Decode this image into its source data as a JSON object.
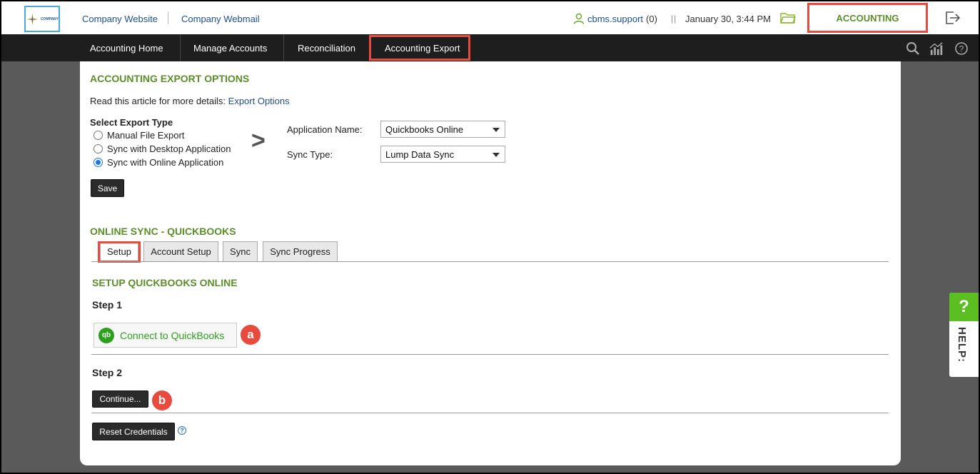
{
  "header": {
    "logo_text": "COMPANY",
    "links": [
      "Company Website",
      "Company Webmail"
    ],
    "user": {
      "name": "cbms.support",
      "count": "(0)"
    },
    "separator": "||",
    "datetime": "January 30, 3:44 PM",
    "module": "ACCOUNTING"
  },
  "nav": {
    "items": [
      "Accounting Home",
      "Manage Accounts",
      "Reconciliation",
      "Accounting Export"
    ],
    "active": "Accounting Export",
    "icons": [
      "search-icon",
      "chart-icon",
      "help-icon"
    ]
  },
  "export_options": {
    "title": "ACCOUNTING EXPORT OPTIONS",
    "intro_text": "Read this article for more details:",
    "intro_link": "Export Options",
    "type_label": "Select Export Type",
    "types": [
      "Manual File Export",
      "Sync with Desktop Application",
      "Sync with Online Application"
    ],
    "selected_type": "Sync with Online Application",
    "arrow": ">",
    "app_label": "Application Name:",
    "app_value": "Quickbooks Online",
    "sync_label": "Sync Type:",
    "sync_value": "Lump Data Sync",
    "save_label": "Save"
  },
  "online_sync": {
    "title": "ONLINE SYNC - QUICKBOOKS",
    "tabs": [
      "Setup",
      "Account Setup",
      "Sync",
      "Sync Progress"
    ],
    "active_tab": "Setup",
    "setup_title": "SETUP QUICKBOOKS ONLINE",
    "step1_label": "Step 1",
    "qb_logo": "qb",
    "connect_label": "Connect to QuickBooks",
    "marker_a": "a",
    "step2_label": "Step 2",
    "continue_label": "Continue...",
    "marker_b": "b",
    "reset_label": "Reset Credentials",
    "help_symbol": "?"
  },
  "help_tab": {
    "symbol": "?",
    "label": "HELP:"
  },
  "colors": {
    "accent_green": "#5c8e2a",
    "highlight_red": "#e84a3e",
    "link_blue": "#1f4f8c",
    "nav_bg": "#1e1e1e",
    "qb_green": "#2ca01c"
  }
}
